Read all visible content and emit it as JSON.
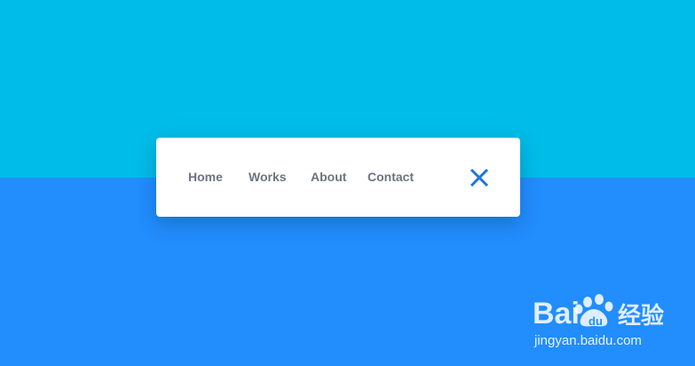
{
  "background": {
    "top_color": "#00bce8",
    "bottom_color": "#228dfd"
  },
  "menu": {
    "card_color": "#ffffff",
    "text_color": "#6b7480",
    "items": [
      {
        "label": "Home"
      },
      {
        "label": "Works"
      },
      {
        "label": "About"
      },
      {
        "label": "Contact"
      }
    ],
    "close_icon": "close-icon",
    "close_color": "#1a77d8"
  },
  "watermark": {
    "logo_text": "Bai  经验",
    "url": "jingyan.baidu.com",
    "color": "#ffffff"
  }
}
